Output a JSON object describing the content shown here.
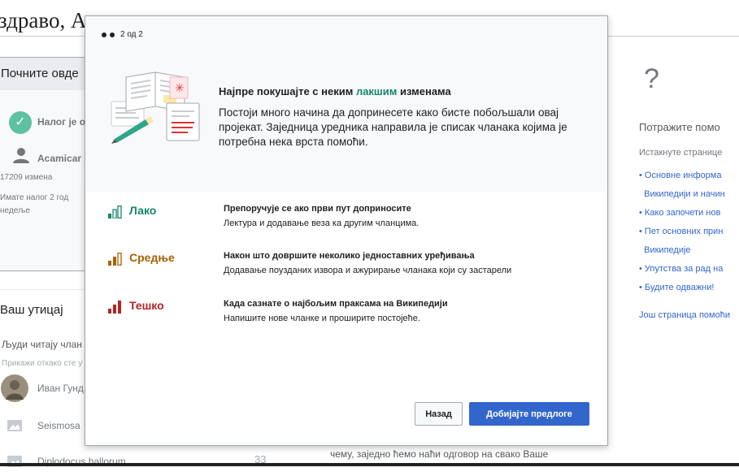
{
  "background": {
    "greeting": "здраво, Ac",
    "start_card": {
      "title": "Почните овде",
      "account_status": "Налог је о",
      "user_name": "Acamicar",
      "edits": "17209 измена",
      "account_age": "Имате налог 2 год недеље"
    },
    "impact": {
      "title": "Ваш утицај",
      "readers": "Људи читају члан",
      "show_since": "Прикажи откако сте у",
      "articles": [
        {
          "name": "Иван Гунд"
        },
        {
          "name": "Seismosa"
        },
        {
          "name": "Diplodocus hallorum",
          "views": "33"
        }
      ]
    },
    "help": {
      "icon": "?",
      "title": "Потражите помо",
      "subtitle": "Истакнуте страницe",
      "links": [
        "Основне информа",
        "Википедији и начин",
        "Како започети нов",
        "Пет основних прин",
        "Википедије",
        "Упутства за рад на",
        "Будите одважни!"
      ],
      "more": "Још страница помоћи"
    },
    "mid_text": "чему, заједно ћемо наћи одговор на свако Ваше"
  },
  "modal": {
    "step_text": "2 од 2",
    "heading_before": "Најпре покушајте с неким ",
    "heading_accent": "лакшим",
    "heading_after": " изменама",
    "body": "Постоји много начина да допринесете како бисте побољшали овај пројекат. Заједница уредника направила је списак чланака којима је потребна нека врста помоћи.",
    "levels": [
      {
        "label": "Лако",
        "color": "#14866d",
        "title": "Препоручује се ако први пут доприносите",
        "desc": "Лектура и додавање веза ка другим чланцима."
      },
      {
        "label": "Средње",
        "color": "#a66200",
        "title": "Након што довршите неколико једноставних уређивања",
        "desc": "Додавање поузданих извора и ажурирање чланака који су застарели"
      },
      {
        "label": "Тешко",
        "color": "#b32424",
        "title": "Када сазнате о најбољим праксама на Википедији",
        "desc": "Напишите нове чланке и проширите постојеће."
      }
    ],
    "back_label": "Назад",
    "next_label": "Добијајте предлоге"
  }
}
